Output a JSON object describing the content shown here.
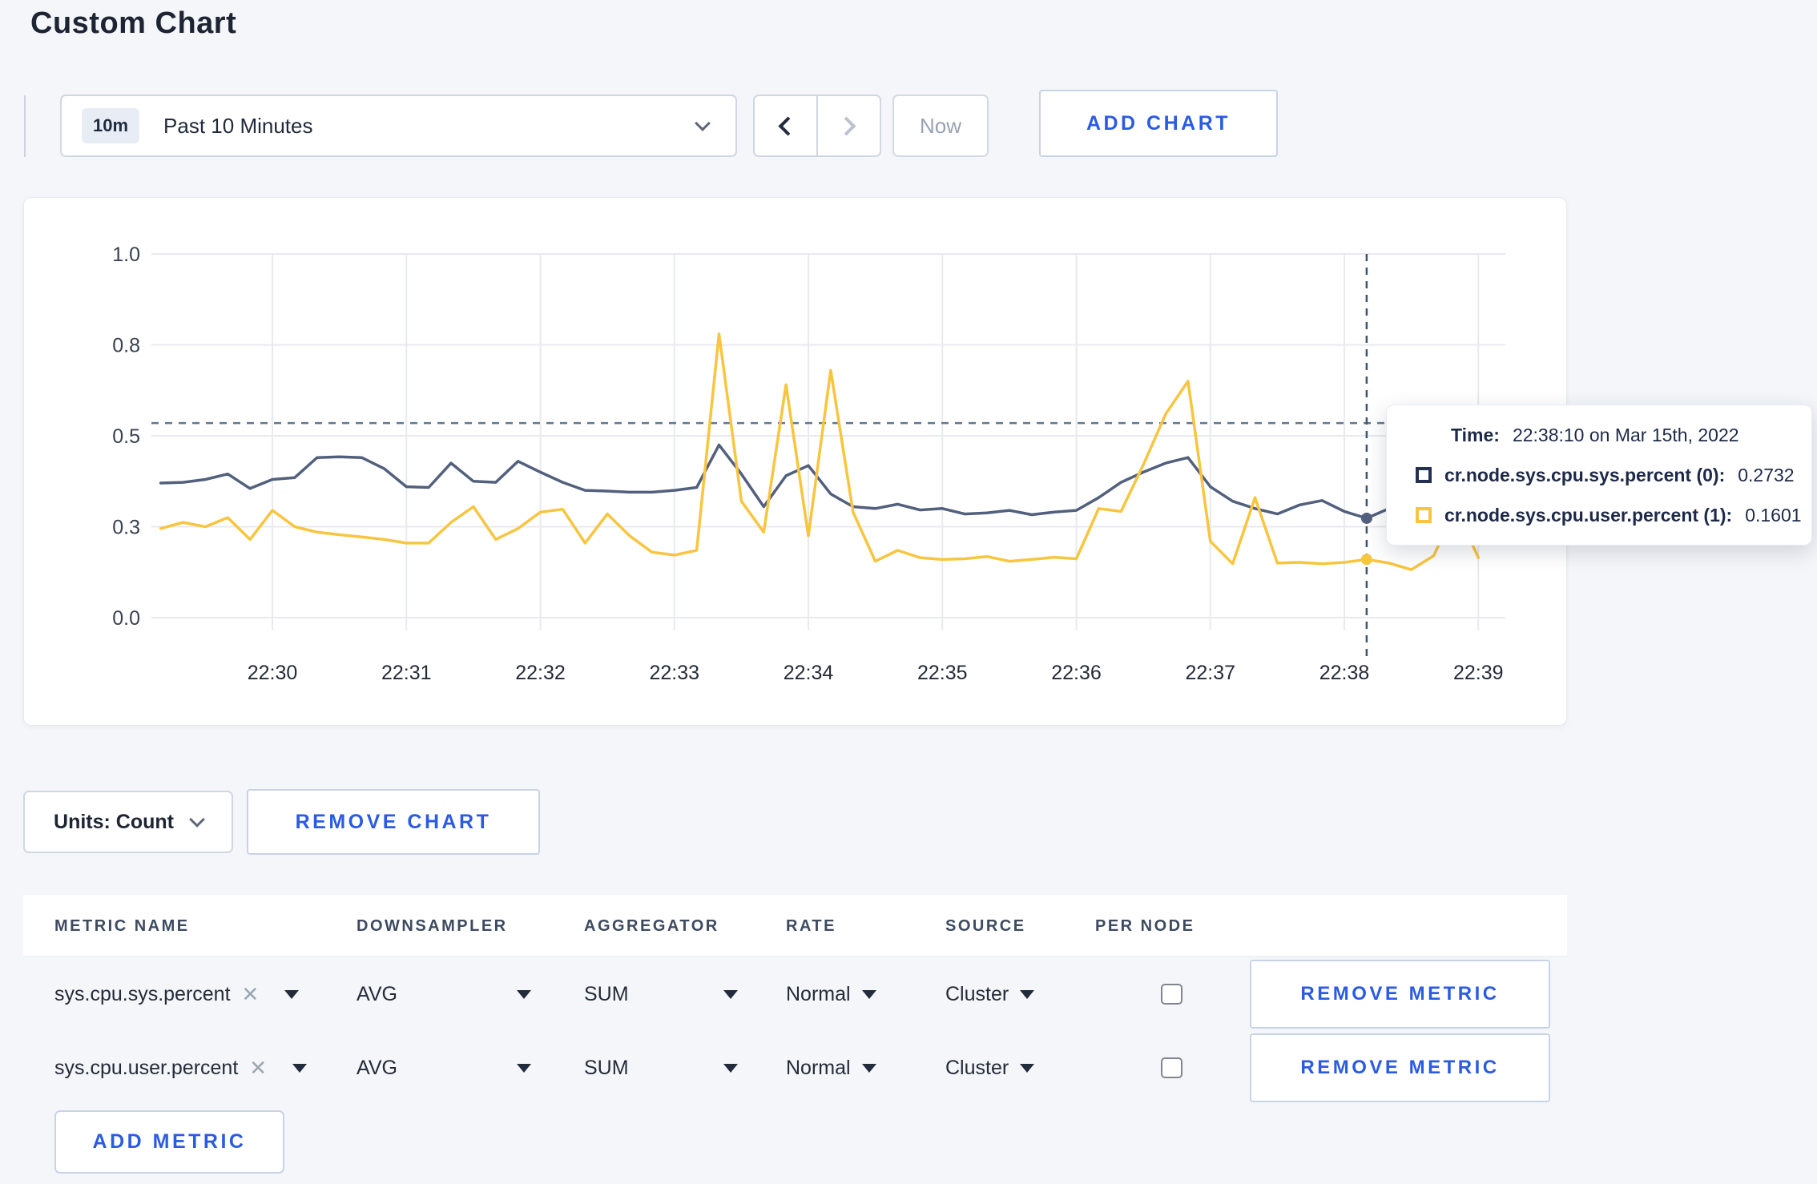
{
  "page": {
    "title": "Custom Chart",
    "background_color": "#f4f6f9",
    "accent_blue": "#2a5be2"
  },
  "toolbar": {
    "time_range_badge": "10m",
    "time_range_label": "Past 10 Minutes",
    "prev_icon": "chevron-left",
    "next_icon": "chevron-right",
    "now_label": "Now",
    "add_chart_label": "ADD CHART"
  },
  "tooltip": {
    "time_label": "Time:",
    "time_value": "22:38:10 on Mar 15th, 2022",
    "series": [
      {
        "label": "cr.node.sys.cpu.sys.percent (0):",
        "value": "0.2732",
        "swatch_color": "#233054"
      },
      {
        "label": "cr.node.sys.cpu.user.percent (1):",
        "value": "0.1601",
        "swatch_color": "#f8c53f"
      }
    ]
  },
  "units_row": {
    "units_label": "Units: Count",
    "remove_chart_label": "REMOVE CHART"
  },
  "metrics_table": {
    "headers": [
      "METRIC NAME",
      "DOWNSAMPLER",
      "AGGREGATOR",
      "RATE",
      "SOURCE",
      "PER NODE"
    ],
    "rows": [
      {
        "name": "sys.cpu.sys.percent",
        "downsampler": "AVG",
        "aggregator": "SUM",
        "rate": "Normal",
        "source": "Cluster",
        "per_node_checked": false,
        "remove_label": "REMOVE METRIC"
      },
      {
        "name": "sys.cpu.user.percent",
        "downsampler": "AVG",
        "aggregator": "SUM",
        "rate": "Normal",
        "source": "Cluster",
        "per_node_checked": false,
        "remove_label": "REMOVE METRIC"
      }
    ],
    "add_metric_label": "ADD METRIC"
  },
  "chart_data": {
    "type": "line",
    "title": "",
    "xlabel": "",
    "ylabel": "",
    "grid": true,
    "ylim": [
      0,
      1
    ],
    "y_ticks": [
      {
        "value": 0,
        "label": "0.0"
      },
      {
        "value": 0.25,
        "label": "0.3"
      },
      {
        "value": 0.5,
        "label": "0.5"
      },
      {
        "value": 0.75,
        "label": "0.8"
      },
      {
        "value": 1,
        "label": "1.0"
      }
    ],
    "x_tick_labels": [
      "22:30",
      "22:31",
      "22:32",
      "22:33",
      "22:34",
      "22:35",
      "22:36",
      "22:37",
      "22:38",
      "22:39"
    ],
    "x_tick_seconds": [
      60,
      120,
      180,
      240,
      300,
      360,
      420,
      480,
      540,
      600
    ],
    "x_start_seconds": 10,
    "x_interval_seconds": 10,
    "series": [
      {
        "name": "cr.node.sys.cpu.sys.percent (0)",
        "line_color": "#52607d",
        "values": [
          0.37,
          0.372,
          0.38,
          0.395,
          0.355,
          0.38,
          0.385,
          0.44,
          0.442,
          0.44,
          0.41,
          0.36,
          0.358,
          0.425,
          0.375,
          0.372,
          0.43,
          0.4,
          0.372,
          0.35,
          0.348,
          0.345,
          0.345,
          0.35,
          0.358,
          0.475,
          0.395,
          0.305,
          0.39,
          0.418,
          0.34,
          0.305,
          0.3,
          0.312,
          0.296,
          0.3,
          0.285,
          0.288,
          0.295,
          0.283,
          0.29,
          0.295,
          0.33,
          0.372,
          0.4,
          0.425,
          0.44,
          0.36,
          0.32,
          0.3,
          0.285,
          0.31,
          0.322,
          0.292,
          0.2732,
          0.3,
          0.302,
          0.295,
          0.3,
          0.305
        ]
      },
      {
        "name": "cr.node.sys.cpu.user.percent (1)",
        "line_color": "#f8c53f",
        "values": [
          0.245,
          0.262,
          0.25,
          0.275,
          0.215,
          0.295,
          0.25,
          0.235,
          0.228,
          0.222,
          0.215,
          0.205,
          0.205,
          0.262,
          0.305,
          0.215,
          0.245,
          0.29,
          0.298,
          0.205,
          0.285,
          0.225,
          0.18,
          0.172,
          0.185,
          0.78,
          0.32,
          0.235,
          0.64,
          0.225,
          0.68,
          0.29,
          0.155,
          0.185,
          0.165,
          0.16,
          0.162,
          0.168,
          0.155,
          0.16,
          0.166,
          0.162,
          0.3,
          0.292,
          0.42,
          0.56,
          0.65,
          0.21,
          0.148,
          0.33,
          0.15,
          0.152,
          0.148,
          0.152,
          0.1601,
          0.15,
          0.132,
          0.17,
          0.3,
          0.165
        ]
      }
    ],
    "crosshair": {
      "time_label": "22:38:10",
      "time_seconds": 550,
      "y_value": 0.535,
      "color": "#60788f"
    },
    "legend_position": "tooltip",
    "grid_color": "#e8eaee"
  }
}
